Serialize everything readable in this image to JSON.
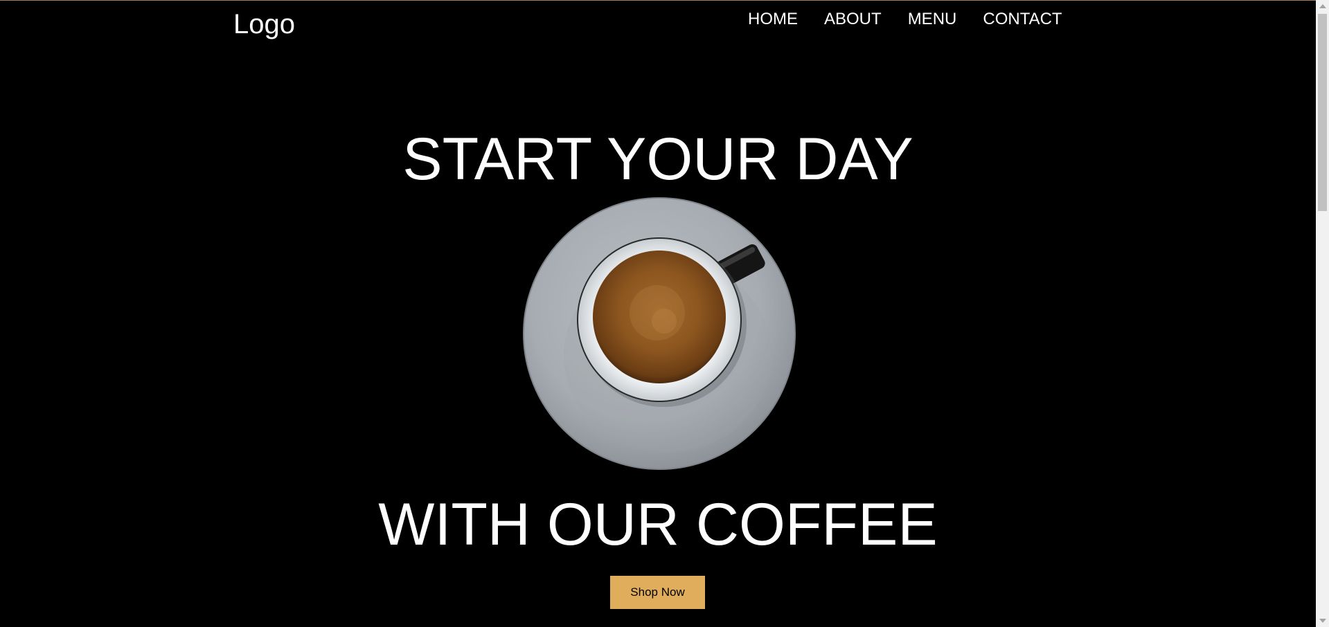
{
  "header": {
    "logo": "Logo",
    "nav": [
      {
        "label": "HOME"
      },
      {
        "label": "ABOUT"
      },
      {
        "label": "MENU"
      },
      {
        "label": "CONTACT"
      }
    ]
  },
  "hero": {
    "headline_top": "START YOUR DAY",
    "headline_bottom": "WITH OUR COFFEE",
    "image_icon": "coffee-cup-image",
    "cta_label": "Shop Now"
  },
  "colors": {
    "background": "#000000",
    "text": "#ffffff",
    "accent": "#e0ad5c"
  }
}
